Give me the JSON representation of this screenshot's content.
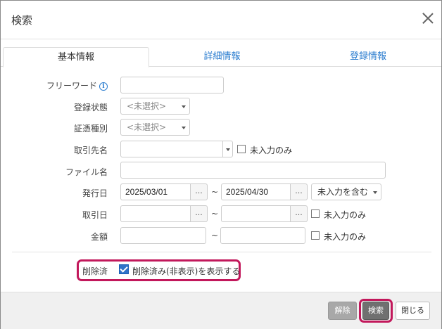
{
  "dialog": {
    "title": "検索"
  },
  "tabs": [
    {
      "label": "基本情報"
    },
    {
      "label": "詳細情報"
    },
    {
      "label": "登録情報"
    }
  ],
  "form": {
    "freeword": {
      "label": "フリーワード",
      "value": ""
    },
    "status": {
      "label": "登録状態",
      "value": "<未選択>"
    },
    "doctype": {
      "label": "証憑種別",
      "value": "<未選択>"
    },
    "partner": {
      "label": "取引先名",
      "value": "",
      "empty_only": "未入力のみ"
    },
    "filename": {
      "label": "ファイル名",
      "value": ""
    },
    "issue_date": {
      "label": "発行日",
      "from": "2025/03/01",
      "to": "2025/04/30",
      "option": "未入力を含む"
    },
    "trade_date": {
      "label": "取引日",
      "from": "",
      "to": "",
      "empty_only": "未入力のみ"
    },
    "amount": {
      "label": "金額",
      "from": "",
      "to": "",
      "empty_only": "未入力のみ"
    },
    "deleted": {
      "label": "削除済",
      "checkbox_label": "削除済み(非表示)を表示する"
    }
  },
  "common": {
    "dots": "...",
    "tilde": "~"
  },
  "footer": {
    "clear": "解除",
    "search": "検索",
    "close": "閉じる"
  },
  "colors": {
    "accent": "#2a7ccf",
    "highlight": "#c2185b",
    "checked": "#2f73c9"
  }
}
